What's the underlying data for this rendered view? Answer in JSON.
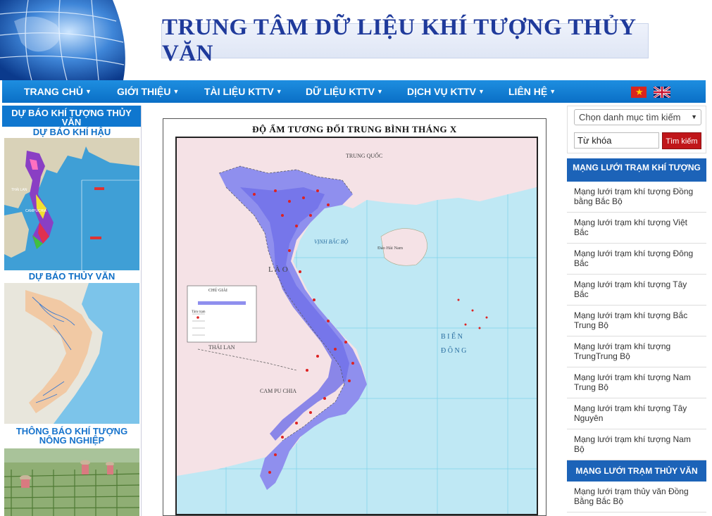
{
  "header": {
    "title": "TRUNG TÂM DỮ LIỆU KHÍ TƯỢNG THỦY VĂN"
  },
  "nav": {
    "items": [
      {
        "label": "TRANG CHỦ"
      },
      {
        "label": "GIỚI THIỆU"
      },
      {
        "label": "TÀI LIỆU KTTV"
      },
      {
        "label": "DỮ LIỆU KTTV"
      },
      {
        "label": "DỊCH VỤ KTTV"
      },
      {
        "label": "LIÊN HỆ"
      }
    ]
  },
  "left": {
    "section_title": "DỰ BÁO KHÍ TƯỢNG THỦY VĂN",
    "climate_title": "DỰ BÁO KHÍ HẬU",
    "hydro_title": "DỰ BÁO THỦY VĂN",
    "agri_title": "THÔNG BÁO KHÍ TƯỢNG NÔNG NGHIỆP"
  },
  "map": {
    "title": "ĐỘ ẨM TƯƠNG ĐỐI TRUNG BÌNH THÁNG X",
    "labels": {
      "trung_quoc": "TRUNG QUỐC",
      "vinh_bac_bo": "VỊNH BẮC BỘ",
      "dao_hai_nam": "Đảo Hải Nam",
      "lao": "L À O",
      "thai_lan": "THÁI LAN",
      "campuchia": "CAM PU CHIA",
      "bien_dong_1": "B I Ể N",
      "bien_dong_2": "Đ Ô N G",
      "legend_title": "CHÚ GIẢI",
      "legend_station": "Tâm trạm"
    }
  },
  "search": {
    "category_placeholder": "Chọn danh mục tìm kiếm",
    "keyword_value": "Từ khóa",
    "button_label": "Tìm kiếm"
  },
  "met_network": {
    "title": "MẠNG LƯỚI TRẠM KHÍ TƯỢNG",
    "items": [
      "Mạng lưới trạm khí tượng Đồng bằng Bắc Bộ",
      "Mạng lưới trạm khí tượng Việt Bắc",
      "Mạng lưới trạm khí tượng Đông Bắc",
      "Mạng lưới trạm khí tượng Tây Bắc",
      "Mạng lưới trạm khí tượng Bắc Trung Bộ",
      "Mạng lưới trạm khí tượng TrungTrung Bộ",
      "Mạng lưới trạm khí tượng Nam Trung Bộ",
      "Mạng lưới trạm khí tượng Tây Nguyên",
      "Mạng lưới trạm khí tượng Nam Bộ"
    ]
  },
  "hydro_network": {
    "title": "MẠNG LƯỚI TRẠM THỦY VĂN",
    "items": [
      "Mạng lưới trạm thủy văn Đồng Bằng Bắc Bộ"
    ]
  },
  "colors": {
    "nav": "#0a6fc6",
    "title_text": "#1f3a9b",
    "search_button": "#c0161a",
    "sidebar_heading": "#1c63b8"
  }
}
